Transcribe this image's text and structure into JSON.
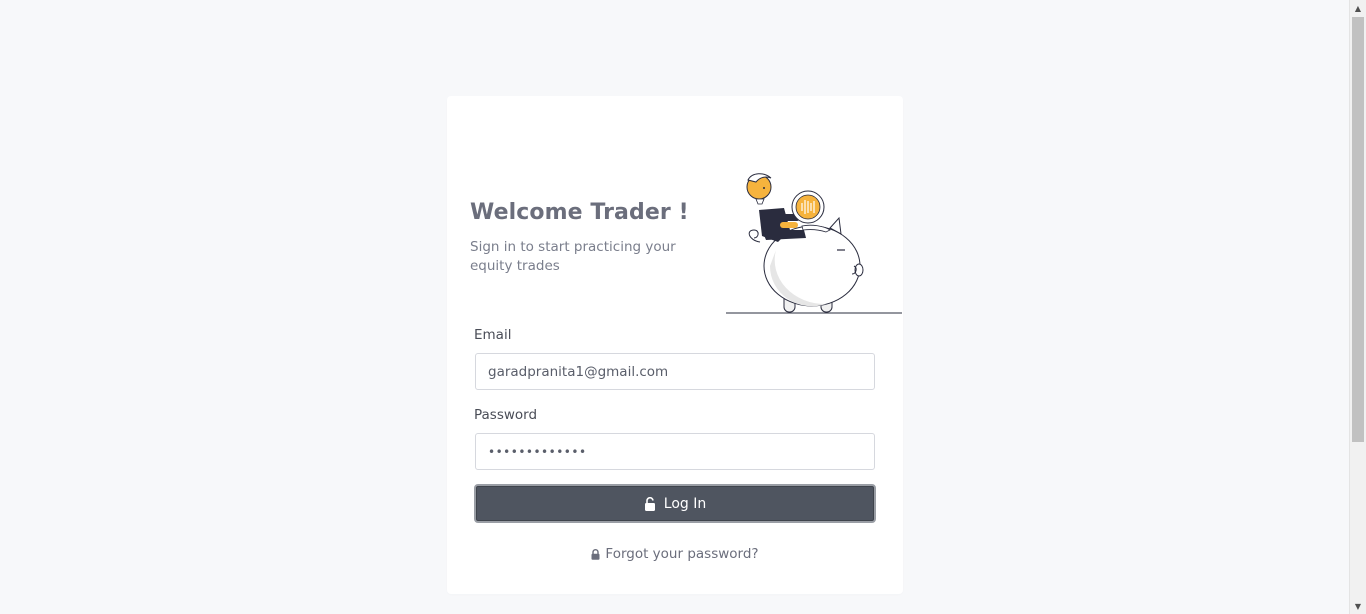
{
  "login": {
    "title": "Welcome Trader !",
    "subtitle": "Sign in to start practicing your equity trades",
    "email_label": "Email",
    "email_value": "garadpranita1@gmail.com",
    "password_label": "Password",
    "password_value": "•••••••••••••",
    "login_button_label": "Log In",
    "forgot_password_label": "Forgot your password?"
  },
  "colors": {
    "page_background": "#f7f8fa",
    "card_background": "#ffffff",
    "button_background": "#4f5560",
    "title_text": "#6b6e7c",
    "accent_orange": "#f6b33d",
    "illustration_dark": "#2a2c3e"
  },
  "icons": {
    "login_button": "unlock-icon",
    "forgot_password": "lock-icon",
    "illustration": "trader-on-piggy-bank-illustration"
  }
}
